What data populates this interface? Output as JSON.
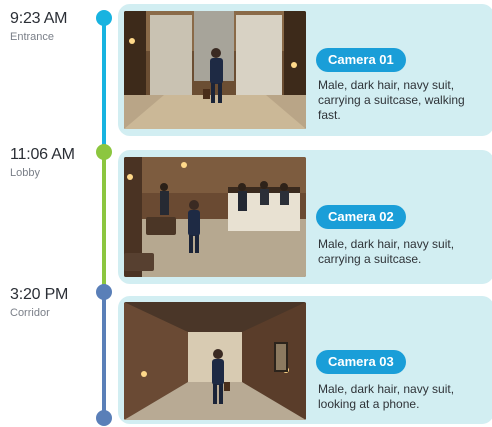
{
  "colors": {
    "segment_1": "#18b3e0",
    "segment_2": "#8cc63f",
    "segment_3": "#5a7fb8",
    "card_bg": "#d2eef2",
    "badge_bg": "#1a9ed8"
  },
  "events": [
    {
      "time": "9:23 AM",
      "location": "Entrance",
      "camera": "Camera 01",
      "description": "Male, dark hair, navy suit, carrying a suitcase, walking fast."
    },
    {
      "time": "11:06 AM",
      "location": "Lobby",
      "camera": "Camera 02",
      "description": "Male, dark hair, navy suit, carrying a suitcase."
    },
    {
      "time": "3:20 PM",
      "location": "Corridor",
      "camera": "Camera 03",
      "description": "Male, dark hair, navy suit, looking at a phone."
    }
  ]
}
